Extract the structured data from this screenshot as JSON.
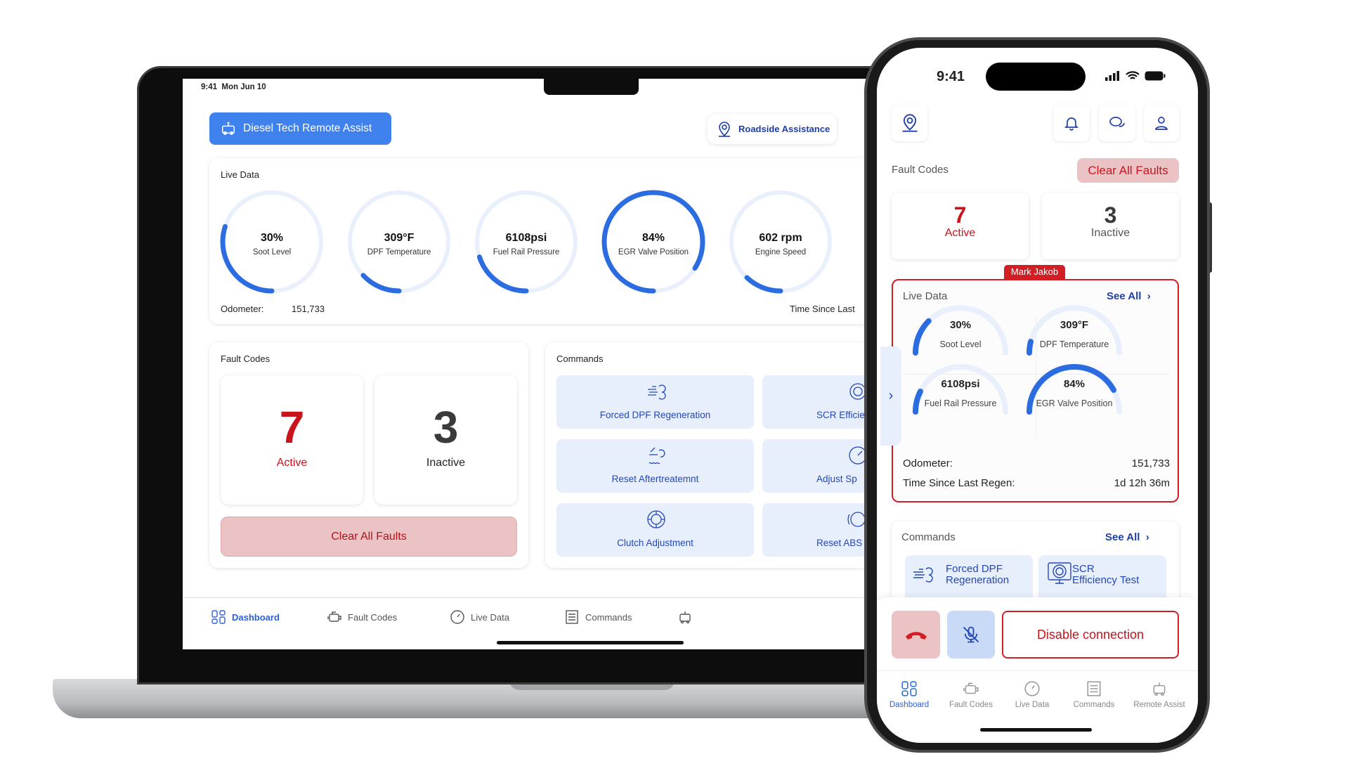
{
  "laptop": {
    "status_time": "9:41",
    "status_date": "Mon Jun 10",
    "primary_button": "Diesel Tech Remote Assist",
    "roadside_button": "Roadside Assistance",
    "live_data": {
      "title": "Live Data",
      "gauges": [
        {
          "value": "30%",
          "label": "Soot Level",
          "fill": 0.3
        },
        {
          "value": "309°F",
          "label": "DPF Temperature",
          "fill": 0.13
        },
        {
          "value": "6108psi",
          "label": "Fuel Rail Pressure",
          "fill": 0.2
        },
        {
          "value": "84%",
          "label": "EGR Valve Position",
          "fill": 0.84
        },
        {
          "value": "602 rpm",
          "label": "Engine Speed",
          "fill": 0.12
        }
      ],
      "odometer_label": "Odometer:",
      "odometer_value": "151,733",
      "time_since_label": "Time Since Last"
    },
    "fault_codes": {
      "title": "Fault Codes",
      "active_count": "7",
      "active_label": "Active",
      "inactive_count": "3",
      "inactive_label": "Inactive",
      "clear_button": "Clear All Faults"
    },
    "commands": {
      "title": "Commands",
      "items": [
        {
          "label": "Forced DPF Regeneration",
          "icon": "dpf-regeneration-icon"
        },
        {
          "label": "SCR Efficiency Test",
          "icon": "scr-test-icon"
        },
        {
          "label": "Reset Aftertreatemnt",
          "icon": "aftertreatment-icon"
        },
        {
          "label": "Adjust Sp",
          "icon": "speed-icon"
        },
        {
          "label": "Clutch Adjustment",
          "icon": "clutch-icon"
        },
        {
          "label": "Reset ABS",
          "icon": "abs-icon"
        }
      ]
    },
    "nav": [
      {
        "label": "Dashboard",
        "icon": "dashboard-icon",
        "active": true
      },
      {
        "label": "Fault Codes",
        "icon": "engine-icon"
      },
      {
        "label": "Live Data",
        "icon": "gauge-icon"
      },
      {
        "label": "Commands",
        "icon": "commands-icon"
      },
      {
        "label": "",
        "icon": "remote-assist-icon"
      }
    ]
  },
  "phone": {
    "status_time": "9:41",
    "fault_codes": {
      "title": "Fault Codes",
      "clear_button": "Clear All Faults",
      "active_count": "7",
      "active_label": "Active",
      "inactive_count": "3",
      "inactive_label": "Inactive"
    },
    "presenter_tag": "Mark Jakob",
    "live_data": {
      "title": "Live Data",
      "see_all": "See All",
      "gauges": [
        {
          "value": "30%",
          "label": "Soot Level",
          "fill": 0.25
        },
        {
          "value": "309°F",
          "label": "DPF Temperature",
          "fill": 0.08
        },
        {
          "value": "6108psi",
          "label": "Fuel Rail Pressure",
          "fill": 0.15
        },
        {
          "value": "84%",
          "label": "EGR Valve Position",
          "fill": 0.84
        }
      ],
      "odometer_label": "Odometer:",
      "odometer_value": "151,733",
      "time_since_label": "Time Since Last Regen:",
      "time_since_value": "1d 12h 36m"
    },
    "commands": {
      "title": "Commands",
      "see_all": "See All",
      "items": [
        {
          "label_line1": "Forced DPF",
          "label_line2": "Regeneration"
        },
        {
          "label_line1": "SCR",
          "label_line2": "Efficiency Test"
        }
      ]
    },
    "call_controls": {
      "disable_button": "Disable connection"
    },
    "tabs": [
      {
        "label": "Dashboard",
        "active": true
      },
      {
        "label": "Fault Codes"
      },
      {
        "label": "Live Data"
      },
      {
        "label": "Commands"
      },
      {
        "label": "Remote Assist"
      }
    ]
  },
  "colors": {
    "accent": "#2f6fe4",
    "danger": "#c8141b",
    "danger_soft": "#ebc3c5",
    "tile": "#e7effd"
  }
}
